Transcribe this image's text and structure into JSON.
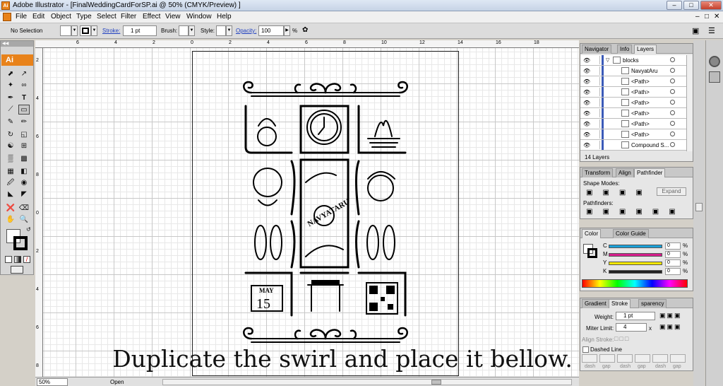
{
  "window": {
    "app_icon": "Ai",
    "title": "Adobe Illustrator - [FinalWeddingCardForSP.ai @ 50% (CMYK/Preview) ]"
  },
  "menu": [
    "File",
    "Edit",
    "Object",
    "Type",
    "Select",
    "Filter",
    "Effect",
    "View",
    "Window",
    "Help"
  ],
  "control": {
    "selection": "No Selection",
    "stroke_label": "Stroke:",
    "stroke_value": "1 pt",
    "brush_label": "Brush:",
    "style_label": "Style:",
    "opacity_label": "Opacity:",
    "opacity_value": "100",
    "opacity_unit": "%"
  },
  "toolbox": {
    "header": "Ai"
  },
  "ruler_top": [
    "6",
    "4",
    "2",
    "0",
    "2",
    "4",
    "6",
    "8",
    "10",
    "12",
    "14",
    "16",
    "18"
  ],
  "ruler_left": [
    "2",
    "4",
    "6",
    "8",
    "0",
    "2",
    "4",
    "6",
    "8"
  ],
  "status": {
    "zoom": "50%",
    "state": "Open"
  },
  "caption": "Duplicate the swirl and place it bellow.",
  "artwork": {
    "calendar_month": "MAY",
    "calendar_day": "15",
    "name_arc": "NAVYATARU"
  },
  "layers_panel": {
    "tabs": [
      "Navigator",
      "Info",
      "Layers"
    ],
    "rows": [
      {
        "name": "blocks",
        "level": 0
      },
      {
        "name": "NavyatAru",
        "level": 1
      },
      {
        "name": "<Path>",
        "level": 1
      },
      {
        "name": "<Path>",
        "level": 1
      },
      {
        "name": "<Path>",
        "level": 1
      },
      {
        "name": "<Path>",
        "level": 1
      },
      {
        "name": "<Path>",
        "level": 1
      },
      {
        "name": "<Path>",
        "level": 1
      },
      {
        "name": "Compound S...",
        "level": 1
      }
    ],
    "footer": "14 Layers"
  },
  "pathfinder_panel": {
    "tabs": [
      "Transform",
      "Align",
      "Pathfinder"
    ],
    "shape_modes": "Shape Modes:",
    "expand": "Expand",
    "pathfinders": "Pathfinders:"
  },
  "color_panel": {
    "tabs": [
      "Color",
      "Color Guide"
    ],
    "channels": [
      {
        "k": "C",
        "v": "0",
        "c": "#1aa0d8"
      },
      {
        "k": "M",
        "v": "0",
        "c": "#d61c8c"
      },
      {
        "k": "Y",
        "v": "0",
        "c": "#f5e600"
      },
      {
        "k": "K",
        "v": "0",
        "c": "#222222"
      }
    ],
    "unit": "%"
  },
  "stroke_panel": {
    "tabs": [
      "Gradient",
      "Stroke",
      "sparency"
    ],
    "weight_label": "Weight:",
    "weight_value": "1 pt",
    "miter_label": "Miter Limit:",
    "miter_value": "4",
    "miter_unit": "x",
    "align_label": "Align Stroke:",
    "dashed_label": "Dashed Line",
    "dash_labels": [
      "dash",
      "gap",
      "dash",
      "gap",
      "dash",
      "gap"
    ]
  }
}
